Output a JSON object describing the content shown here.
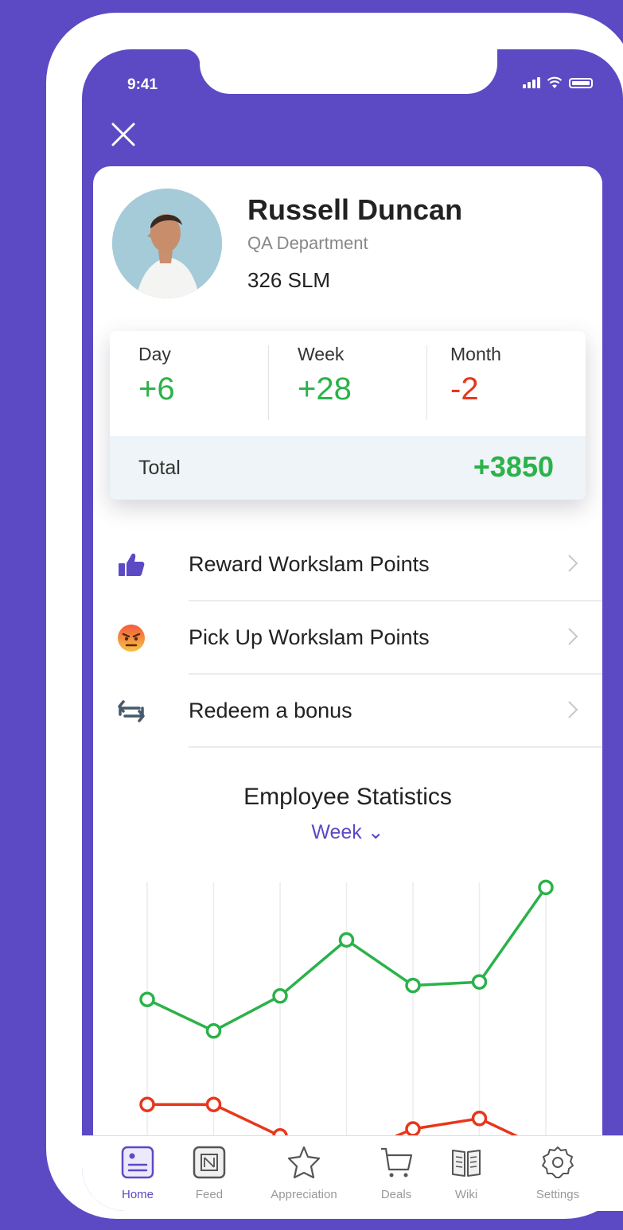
{
  "status_bar": {
    "time": "9:41"
  },
  "profile": {
    "name": "Russell Duncan",
    "department": "QA Department",
    "points": "326 SLM"
  },
  "stats": {
    "day": {
      "label": "Day",
      "value": "+6"
    },
    "week": {
      "label": "Week",
      "value": "+28"
    },
    "month": {
      "label": "Month",
      "value": "-2"
    },
    "total": {
      "label": "Total",
      "value": "+3850"
    }
  },
  "menu": [
    {
      "label": "Reward Workslam Points",
      "icon": "thumbs-up-icon"
    },
    {
      "label": "Pick Up Workslam Points",
      "icon": "angry-face-icon"
    },
    {
      "label": "Redeem a bonus",
      "icon": "repeat-icon"
    }
  ],
  "statistics": {
    "title": "Employee Statistics",
    "period": "Week ⌄"
  },
  "chart_data": {
    "type": "line",
    "x": [
      1,
      2,
      3,
      4,
      5,
      6,
      7
    ],
    "ylim": [
      0,
      10
    ],
    "grid": true,
    "series": [
      {
        "color": "#2bb24a",
        "values": [
          6.2,
          5.3,
          6.3,
          7.9,
          6.6,
          6.7,
          9.4
        ]
      },
      {
        "color": "#e8361c",
        "values": [
          3.2,
          3.2,
          2.3,
          1.7,
          2.5,
          2.8,
          1.9
        ]
      }
    ]
  },
  "tabs": [
    {
      "label": "Home",
      "icon": "home-icon",
      "active": true
    },
    {
      "label": "Feed",
      "icon": "feed-icon"
    },
    {
      "label": "Appreciation",
      "icon": "star-icon"
    },
    {
      "label": "Deals",
      "icon": "cart-icon"
    },
    {
      "label": "Wiki",
      "icon": "book-icon"
    },
    {
      "label": "Settings",
      "icon": "gear-icon"
    }
  ],
  "colors": {
    "brand": "#5b4ac4",
    "positive": "#2bb24a",
    "negative": "#e8361c"
  }
}
